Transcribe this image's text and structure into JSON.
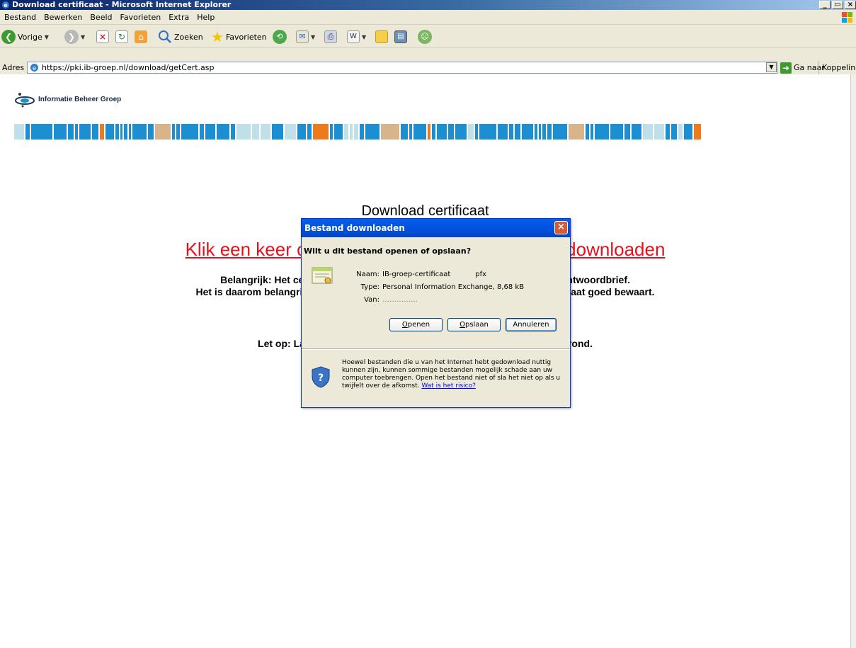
{
  "window": {
    "title": "Download certificaat - Microsoft Internet Explorer",
    "controls": [
      "_",
      "▭",
      "×"
    ]
  },
  "menu": [
    "Bestand",
    "Bewerken",
    "Beeld",
    "Favorieten",
    "Extra",
    "Help"
  ],
  "toolbar": {
    "back_label": "Vorige",
    "search_label": "Zoeken",
    "favorites_label": "Favorieten"
  },
  "address": {
    "label": "Adres",
    "url": "https://pki.ib-groep.nl/download/getCert.asp",
    "go_label": "Ga naar",
    "links_label": "Koppelingen"
  },
  "page": {
    "logo_text": "Informatie Beheer Groep",
    "heading": "Download certificaat",
    "link_text": "Klik een keer op deze link om het certificaat te downloaden",
    "info_line1": "Belangrijk: Het certificaat wordt beveiligd met het wachtwoord uit uw wachtwoordbrief.",
    "info_line2": "Het is daarom belangrijk dat u de wachtwoordbrief en het handtekeningscertificaat goed bewaart.",
    "info_line3": "Let op: Laat dit scherm openstaan totdat u de installatie hebt afgerond."
  },
  "dialog": {
    "title": "Bestand downloaden",
    "question": "Wilt u dit bestand openen of opslaan?",
    "name_key": "Naam:",
    "name_value": "IB-groep-certificaat           pfx",
    "type_key": "Type:",
    "type_value": "Personal Information Exchange, 8,68 kB",
    "from_key": "Van:",
    "from_value": "……………",
    "open_label": "Openen",
    "save_label": "Opslaan",
    "cancel_label": "Annuleren",
    "warning_text": "Hoewel bestanden die u van het Internet hebt gedownload nuttig kunnen zijn, kunnen sommige bestanden mogelijk schade aan uw computer toebrengen. Open het bestand niet of sla het niet op als u twijfelt over de afkomst.",
    "risk_link": "Wat is het risico?"
  },
  "colors": {
    "link_red": "#E8101A",
    "stripe_blue": "#1B8FD2",
    "stripe_orange": "#EE7A1E",
    "stripe_tan": "#D7B48A",
    "stripe_light": "#BFE0E8",
    "dialog_title_blue": "#0054E3"
  }
}
